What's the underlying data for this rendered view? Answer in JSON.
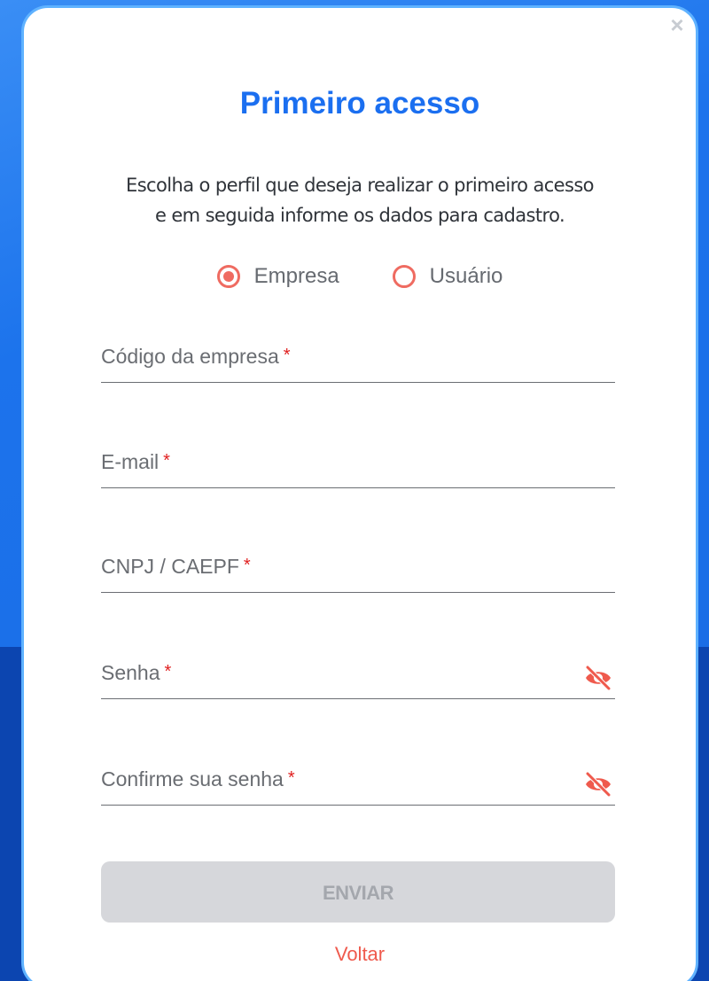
{
  "modal": {
    "close_symbol": "×",
    "title": "Primeiro acesso",
    "description_line1": "Escolha o perfil que deseja realizar o primeiro acesso",
    "description_line2": "e em seguida informe os dados para cadastro.",
    "profile_options": [
      {
        "label": "Empresa",
        "selected": true
      },
      {
        "label": "Usuário",
        "selected": false
      }
    ],
    "fields": [
      {
        "label": "Código da empresa",
        "required_mark": "*",
        "value": ""
      },
      {
        "label": "E-mail",
        "required_mark": "*",
        "value": ""
      },
      {
        "label": "CNPJ / CAEPF",
        "required_mark": "*",
        "value": ""
      },
      {
        "label": "Senha",
        "required_mark": "*",
        "value": "",
        "icon": "eye-off-icon"
      },
      {
        "label": "Confirme sua senha",
        "required_mark": "*",
        "value": "",
        "icon": "eye-off-icon"
      }
    ],
    "submit_label": "ENVIAR",
    "back_label": "Voltar"
  },
  "colors": {
    "accent": "#ef6b61",
    "title": "#1b6ff0",
    "required": "#e02020",
    "button_disabled_bg": "#d6d7db",
    "background_blue": "#1a6ee8",
    "modal_border": "#5fb2ff"
  }
}
